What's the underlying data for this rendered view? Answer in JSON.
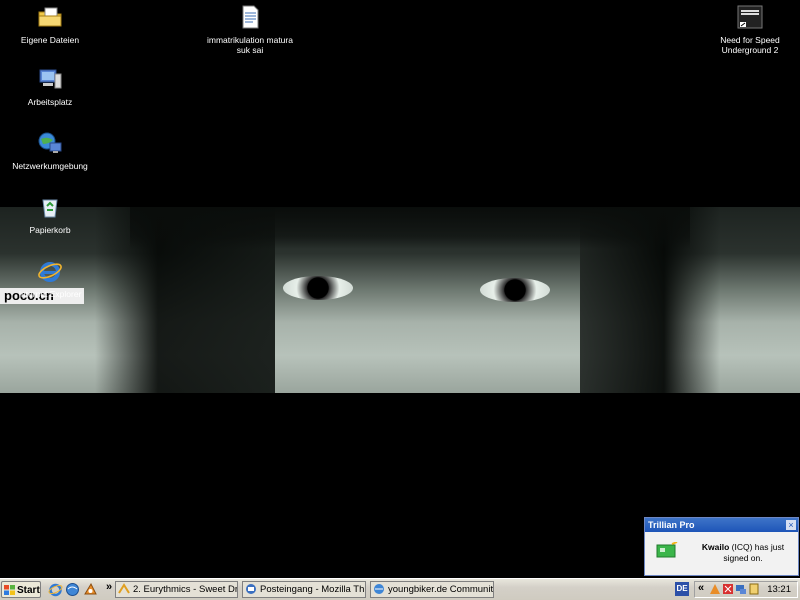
{
  "desktop": {
    "icons": [
      {
        "label": "Eigene Dateien",
        "icon": "my-documents-icon"
      },
      {
        "label": "Arbeitsplatz",
        "icon": "my-computer-icon"
      },
      {
        "label": "Netzwerkumgebung",
        "icon": "network-icon"
      },
      {
        "label": "Papierkorb",
        "icon": "recycle-bin-icon"
      },
      {
        "label": "Internet Explorer",
        "icon": "ie-icon"
      },
      {
        "label": "immatrikulation matura suk sai",
        "icon": "document-icon"
      },
      {
        "label": "Need for Speed Underground 2",
        "icon": "nfs-shortcut-icon"
      }
    ],
    "wallpaper_brand": "poco.cn"
  },
  "taskbar": {
    "start_label": "Start",
    "chevron": "»",
    "buttons": [
      {
        "label": "2. Eurythmics - Sweet Dr...",
        "icon": "winamp-icon"
      },
      {
        "label": "Posteingang - Mozilla Th...",
        "icon": "thunderbird-icon"
      },
      {
        "label": "youngbiker.de Communit...",
        "icon": "browser-icon"
      }
    ],
    "language": "DE",
    "tray_chevron": "«",
    "clock": "13:21"
  },
  "notification": {
    "title": "Trillian Pro",
    "close": "×",
    "user": "Kwailo",
    "text": "(ICQ) has just signed on."
  },
  "colors": {
    "title_bar": "#2a62c6",
    "taskbar": "#d4d0c8",
    "desktop": "#000000"
  }
}
